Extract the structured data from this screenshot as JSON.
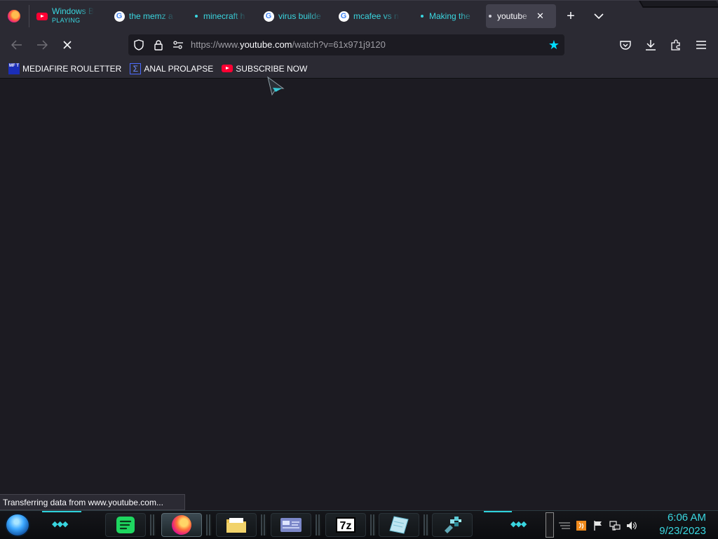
{
  "tabs": [
    {
      "title": "Windows B",
      "subtitle": "PLAYING",
      "icon": "youtube-icon"
    },
    {
      "title": "the memz a",
      "icon": "google-icon"
    },
    {
      "title": "minecraft h",
      "icon": "dot-icon"
    },
    {
      "title": "virus builde",
      "icon": "google-icon"
    },
    {
      "title": "mcafee vs n",
      "icon": "google-icon"
    },
    {
      "title": "Making the",
      "icon": "dot-icon"
    },
    {
      "title": "youtube",
      "icon": "dot-icon",
      "active": true,
      "close": "✕"
    }
  ],
  "tabstrip": {
    "new_tab": "+",
    "list_all": "⌄"
  },
  "navbar": {
    "url_prefix": "https://www.",
    "url_host": "youtube.com",
    "url_rest": "/watch?v=61x971j9120",
    "star": "★"
  },
  "bookmarks": [
    {
      "label": "MEDIAFIRE ROULETTER",
      "icon_text": "MF T"
    },
    {
      "label": "ANAL PROLAPSE",
      "icon_text": "Σ"
    },
    {
      "label": "SUBSCRIBE NOW"
    }
  ],
  "status_text": "Transferring data from www.youtube.com...",
  "taskbar": {
    "apps": [
      "spotify",
      "firefox",
      "file-explorer",
      "control-panel",
      "7-zip",
      "notepad",
      "minecraft"
    ],
    "sevenzip_label": "7z",
    "time": "6:06 AM",
    "date": "9/23/2023"
  },
  "colors": {
    "accent_teal": "#3ad7e0",
    "bookmark_star": "#00ddff",
    "background": "#1c1b22",
    "chrome": "#2b2a33"
  }
}
